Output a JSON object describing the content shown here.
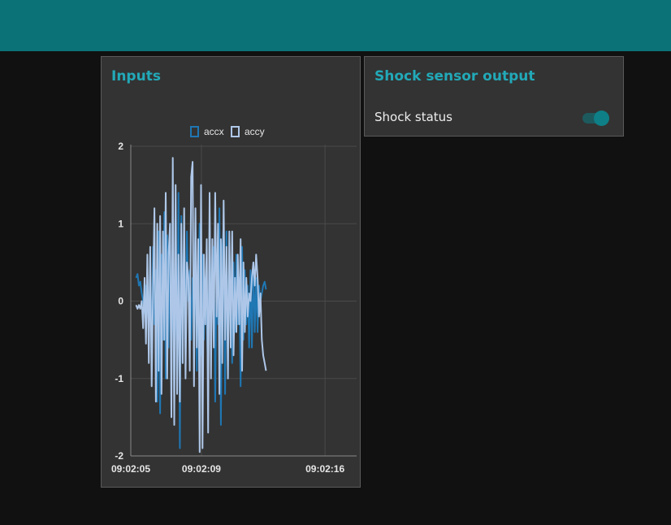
{
  "colors": {
    "topbar": "#0b7378",
    "background": "#111111",
    "card": "#333333",
    "accent": "#22a9b8",
    "series_accx": "#1f77b4",
    "series_accy": "#aec7e8"
  },
  "header": {
    "title": ""
  },
  "inputs_card": {
    "title": "Inputs"
  },
  "shock_card": {
    "title": "Shock sensor output",
    "row_label": "Shock status",
    "toggle_state": true,
    "toggle_icon": "toggle-switch-icon"
  },
  "chart_data": {
    "type": "line",
    "title": "",
    "xlabel": "",
    "ylabel": "",
    "ylim": [
      -2,
      2
    ],
    "yticks": [
      "2",
      "1",
      "0",
      "-1",
      "-2"
    ],
    "xticks": [
      "09:02:05",
      "09:02:09",
      "09:02:16"
    ],
    "xlim_seconds": [
      0,
      11.5
    ],
    "xtick_seconds": [
      0,
      4,
      11
    ],
    "grid": true,
    "legend_position": "top-center",
    "series": [
      {
        "name": "accx",
        "t_start": 0.3,
        "t_step": 0.08,
        "values": [
          0.3,
          0.35,
          0.2,
          0.25,
          0.1,
          0.0,
          -0.15,
          0.2,
          0.0,
          -0.4,
          0.6,
          -0.9,
          0.7,
          -0.3,
          0.4,
          -1.3,
          0.9,
          -1.45,
          0.6,
          -0.5,
          1.15,
          -1.0,
          0.85,
          -0.6,
          1.0,
          -1.0,
          0.8,
          -1.25,
          0.7,
          -1.0,
          1.4,
          -1.9,
          1.1,
          -0.8,
          0.9,
          -0.7,
          0.9,
          0.0,
          0.4,
          -0.5,
          0.3,
          0.0,
          0.9,
          -0.9,
          0.3,
          1.0,
          -0.7,
          0.6,
          -0.5,
          0.3,
          -0.2,
          -1.0,
          1.1,
          -0.4,
          0.2,
          0.7,
          -1.3,
          0.4,
          -0.3,
          1.2,
          -1.6,
          0.6,
          1.0,
          -1.2,
          0.9,
          -1.0,
          0.7,
          0.0,
          -0.8,
          0.5,
          -0.4,
          0.6,
          -0.3,
          0.3,
          -1.1,
          0.7,
          -0.5,
          0.4,
          -0.3,
          0.2,
          -0.6,
          0.4,
          -0.6,
          0.5,
          -0.4,
          0.3,
          -0.4,
          0.2,
          0.0,
          0.1,
          0.2,
          0.25,
          0.15
        ]
      },
      {
        "name": "accy",
        "t_start": 0.3,
        "t_step": 0.08,
        "values": [
          -0.05,
          -0.1,
          -0.05,
          -0.1,
          0.0,
          -0.35,
          0.3,
          -0.55,
          0.6,
          -0.8,
          0.7,
          -1.1,
          0.1,
          1.2,
          -1.3,
          1.0,
          -0.9,
          1.1,
          -1.2,
          0.9,
          -0.5,
          1.4,
          -1.0,
          0.6,
          1.0,
          -1.5,
          1.85,
          -1.6,
          1.5,
          -1.2,
          0.6,
          -1.3,
          1.0,
          -0.8,
          1.2,
          -1.0,
          0.5,
          0.3,
          -0.9,
          1.6,
          1.8,
          -1.1,
          1.2,
          -0.6,
          0.8,
          -1.95,
          1.5,
          -1.9,
          0.6,
          -0.3,
          0.8,
          -1.7,
          1.4,
          -1.0,
          0.8,
          -0.6,
          1.4,
          -0.2,
          1.0,
          -1.2,
          0.8,
          -0.8,
          1.3,
          -0.5,
          0.7,
          -1.0,
          0.9,
          -0.6,
          0.9,
          -0.7,
          0.3,
          -0.4,
          0.6,
          -0.3,
          0.8,
          -0.9,
          0.5,
          -0.4,
          0.3,
          -0.2,
          0.1,
          0.0,
          0.3,
          0.5,
          0.2,
          0.6,
          0.3,
          -0.2,
          0.1,
          -0.5,
          -0.7,
          -0.8,
          -0.9
        ]
      }
    ]
  }
}
